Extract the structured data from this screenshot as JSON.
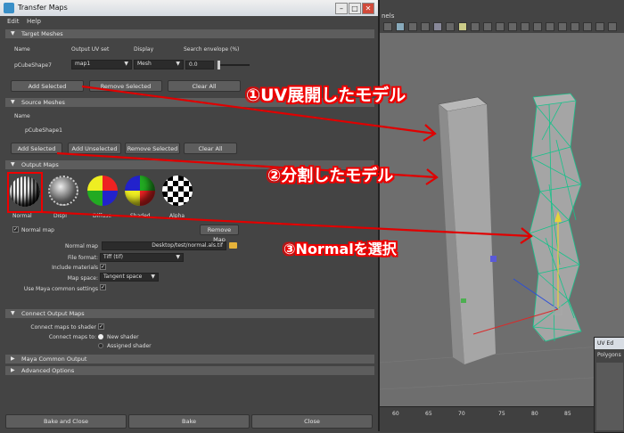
{
  "window": {
    "title": "Transfer Maps",
    "menus": [
      "Edit",
      "Help"
    ]
  },
  "target_meshes": {
    "header": "Target Meshes",
    "col_name": "Name",
    "col_uv": "Output UV set",
    "col_display": "Display",
    "col_search": "Search envelope (%)",
    "row_name": "pCubeShape7",
    "row_uv": "map1",
    "row_display": "Mesh",
    "row_search": "0.0",
    "add": "Add Selected",
    "remove": "Remove Selected",
    "clear": "Clear All"
  },
  "source_meshes": {
    "header": "Source Meshes",
    "col_name": "Name",
    "row_name": "pCubeShape1",
    "add": "Add Selected",
    "add_unselected": "Add Unselected",
    "remove": "Remove Selected",
    "clear": "Clear All"
  },
  "output_maps": {
    "header": "Output Maps",
    "maps": [
      "Normal",
      "Displ",
      "Diffuse",
      "Shaded",
      "Alpha"
    ],
    "normal_map_check": "Normal map",
    "remove_map": "Remove Map",
    "normal_map_label": "Normal map",
    "normal_map_value": "Desktop/test/normal.als.tif",
    "file_format_label": "File format:",
    "file_format_value": "Tiff (tif)",
    "include_materials_label": "Include materials",
    "map_space_label": "Map space:",
    "map_space_value": "Tangent space",
    "maya_common_label": "Use Maya common settings"
  },
  "connect_output": {
    "header": "Connect Output Maps",
    "connect_shaders": "Connect maps to shader",
    "connect_to": "Connect maps to:",
    "opt_new": "New shader",
    "opt_assigned": "Assigned shader"
  },
  "collapsed": {
    "common": "Maya Common Output",
    "advanced": "Advanced Options"
  },
  "bottom": {
    "bake_close": "Bake and Close",
    "bake": "Bake",
    "close": "Close"
  },
  "viewport": {
    "menu_label": "nels",
    "uv_editor": "UV Ed",
    "polygons": "Polygons",
    "ruler": [
      "60",
      "65",
      "70",
      "75",
      "80",
      "85"
    ]
  },
  "annotations": {
    "a1": "①UV展開したモデル",
    "a2": "②分割したモデル",
    "a3": "③Normalを選択"
  },
  "colors": {
    "annotation_red": "#e00000",
    "panel": "#444444",
    "viewport": "#6e6e6e",
    "wire": "#16c28a"
  }
}
